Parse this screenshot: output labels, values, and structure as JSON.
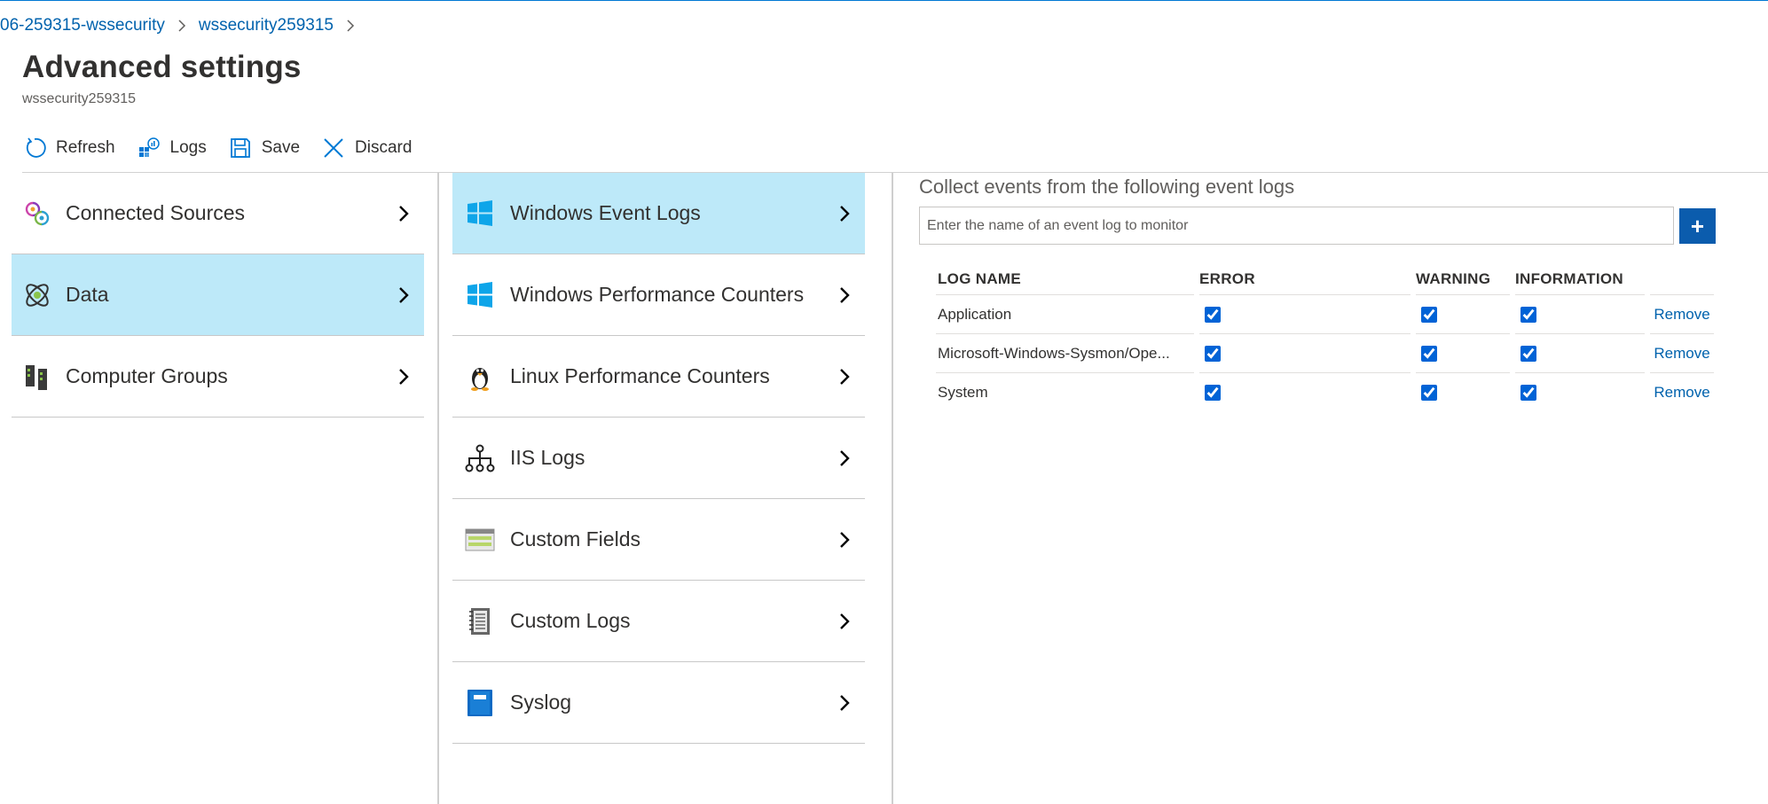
{
  "breadcrumb": {
    "items": [
      "06-259315-wssecurity",
      "wssecurity259315"
    ]
  },
  "page": {
    "title": "Advanced settings",
    "subtitle": "wssecurity259315"
  },
  "toolbar": {
    "refresh_label": "Refresh",
    "logs_label": "Logs",
    "save_label": "Save",
    "discard_label": "Discard"
  },
  "settings_nav": {
    "items": [
      {
        "label": "Connected Sources",
        "icon": "connected-sources-icon",
        "selected": false
      },
      {
        "label": "Data",
        "icon": "data-icon",
        "selected": true
      },
      {
        "label": "Computer Groups",
        "icon": "computer-groups-icon",
        "selected": false
      }
    ]
  },
  "data_nav": {
    "items": [
      {
        "label": "Windows Event Logs",
        "icon": "windows-icon",
        "selected": true
      },
      {
        "label": "Windows Performance Counters",
        "icon": "windows-icon",
        "selected": false
      },
      {
        "label": "Linux Performance Counters",
        "icon": "linux-penguin-icon",
        "selected": false
      },
      {
        "label": "IIS Logs",
        "icon": "network-tree-icon",
        "selected": false
      },
      {
        "label": "Custom Fields",
        "icon": "custom-fields-icon",
        "selected": false
      },
      {
        "label": "Custom Logs",
        "icon": "notebook-icon",
        "selected": false
      },
      {
        "label": "Syslog",
        "icon": "book-icon",
        "selected": false
      }
    ]
  },
  "event_logs": {
    "heading": "Collect events from the following event logs",
    "input_placeholder": "Enter the name of an event log to monitor",
    "add_label": "+",
    "columns": {
      "name": "LOG NAME",
      "error": "ERROR",
      "warning": "WARNING",
      "information": "INFORMATION"
    },
    "rows": [
      {
        "name": "Application",
        "error": true,
        "warning": true,
        "information": true,
        "action": "Remove"
      },
      {
        "name": "Microsoft-Windows-Sysmon/Ope...",
        "error": true,
        "warning": true,
        "information": true,
        "action": "Remove"
      },
      {
        "name": "System",
        "error": true,
        "warning": true,
        "information": true,
        "action": "Remove"
      }
    ]
  },
  "colors": {
    "accent": "#0078d4",
    "link": "#0062ad",
    "selected_bg": "#bde9f9",
    "add_button": "#0b5cad"
  }
}
